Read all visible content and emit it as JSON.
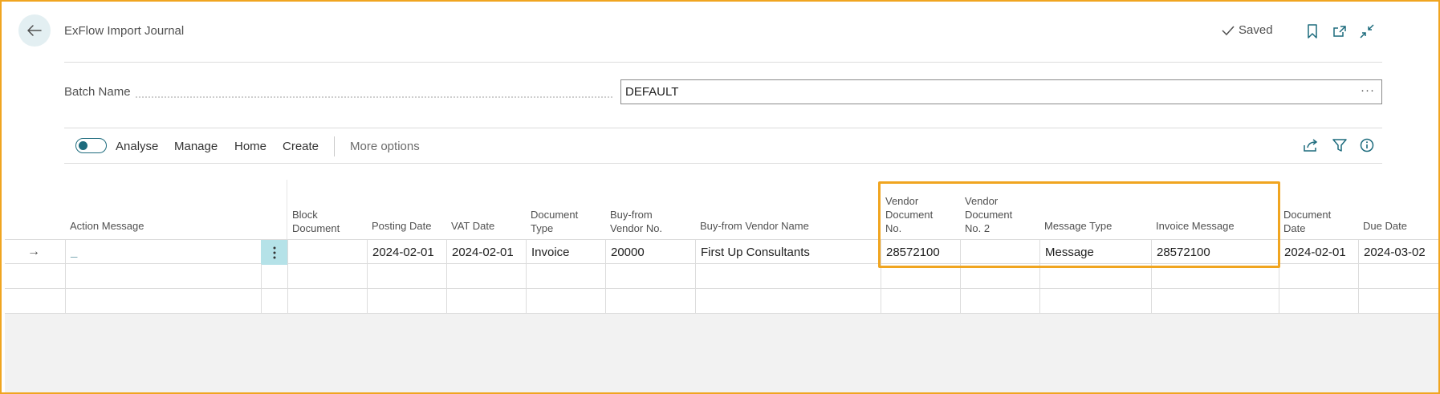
{
  "header": {
    "title": "ExFlow Import Journal",
    "saved_label": "Saved"
  },
  "batch": {
    "label": "Batch Name",
    "value": "DEFAULT",
    "ellipsis": "···"
  },
  "actions": {
    "analyse": "Analyse",
    "manage": "Manage",
    "home": "Home",
    "create": "Create",
    "more": "More options"
  },
  "columns": {
    "action_message": "Action Message",
    "block_document_1": "Block",
    "block_document_2": "Document",
    "posting_date": "Posting Date",
    "vat_date": "VAT Date",
    "document_type_1": "Document",
    "document_type_2": "Type",
    "buy_from_vendor_no_1": "Buy-from",
    "buy_from_vendor_no_2": "Vendor No.",
    "buy_from_vendor_name": "Buy-from Vendor Name",
    "vendor_document_no_1": "Vendor",
    "vendor_document_no_2": "Document",
    "vendor_document_no_3": "No.",
    "vendor_document_no2_1": "Vendor",
    "vendor_document_no2_2": "Document",
    "vendor_document_no2_3": "No. 2",
    "message_type": "Message Type",
    "invoice_message": "Invoice Message",
    "document_date_1": "Document",
    "document_date_2": "Date",
    "due_date": "Due Date"
  },
  "rows": [
    {
      "action_message": "_",
      "block_document": "",
      "posting_date": "2024-02-01",
      "vat_date": "2024-02-01",
      "document_type": "Invoice",
      "buy_from_vendor_no": "20000",
      "buy_from_vendor_name": "First Up Consultants",
      "vendor_document_no": "28572100",
      "vendor_document_no2": "",
      "message_type": "Message",
      "invoice_message": "28572100",
      "document_date": "2024-02-01",
      "due_date": "2024-03-02"
    }
  ],
  "colors": {
    "highlight": "#f0a520",
    "accent": "#1d6b7d",
    "selected_cell": "#b5e2e8"
  }
}
